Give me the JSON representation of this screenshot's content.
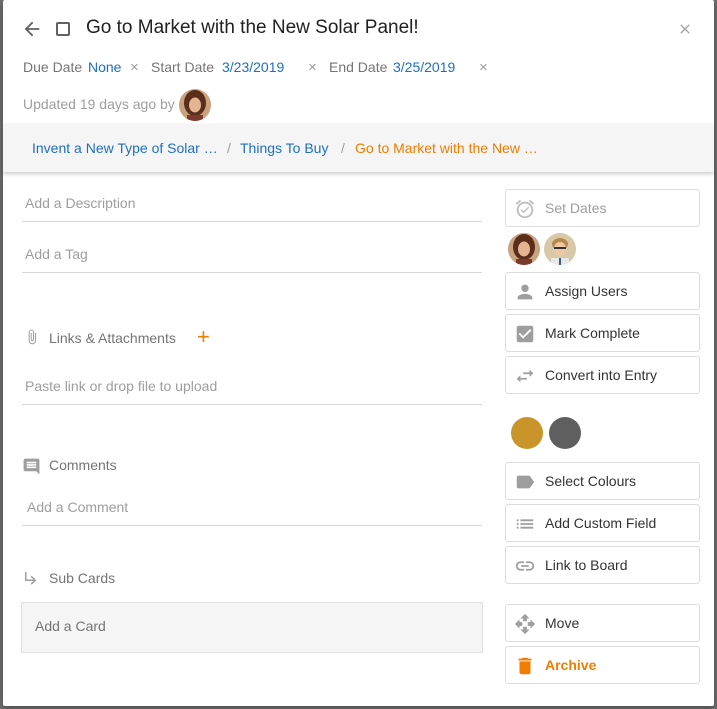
{
  "card": {
    "title": "Go to Market with the New Solar Panel!",
    "due_label": "Due Date",
    "due_value": "None",
    "start_label": "Start Date",
    "start_value": "3/23/2019",
    "end_label": "End Date",
    "end_value": "3/25/2019",
    "clear_glyph": "×",
    "updated_text": "Updated 19 days ago by"
  },
  "breadcrumb": {
    "items": [
      "Invent a New Type of Solar …",
      "Things To Buy",
      "Go to Market with the New …"
    ],
    "separator": "/"
  },
  "main": {
    "description_placeholder": "Add a Description",
    "tag_placeholder": "Add a Tag",
    "links_label": "Links & Attachments",
    "links_add": "+",
    "link_placeholder": "Paste link or drop file to upload",
    "comments_label": "Comments",
    "comment_placeholder": "Add a Comment",
    "subcards_label": "Sub Cards",
    "add_card": "Add a Card"
  },
  "sidebar": {
    "set_dates": "Set Dates",
    "assign_users": "Assign Users",
    "mark_complete": "Mark Complete",
    "convert": "Convert into Entry",
    "select_colours": "Select Colours",
    "custom_field": "Add Custom Field",
    "link_board": "Link to Board",
    "move": "Move",
    "archive": "Archive"
  },
  "colors": {
    "accent": "#ef7d00",
    "link": "#1e6fc2",
    "swatch_gold": "#c9952a",
    "swatch_gray": "#5f5f5f"
  },
  "icons": [
    "back-arrow-icon",
    "checkbox-icon",
    "close-icon",
    "paperclip-icon",
    "comment-icon",
    "subcard-arrow-icon",
    "alarm-clock-icon",
    "person-icon",
    "checkmark-icon",
    "swap-arrows-icon",
    "label-tag-icon",
    "list-icon",
    "link-icon",
    "move-arrows-icon",
    "trash-icon"
  ]
}
